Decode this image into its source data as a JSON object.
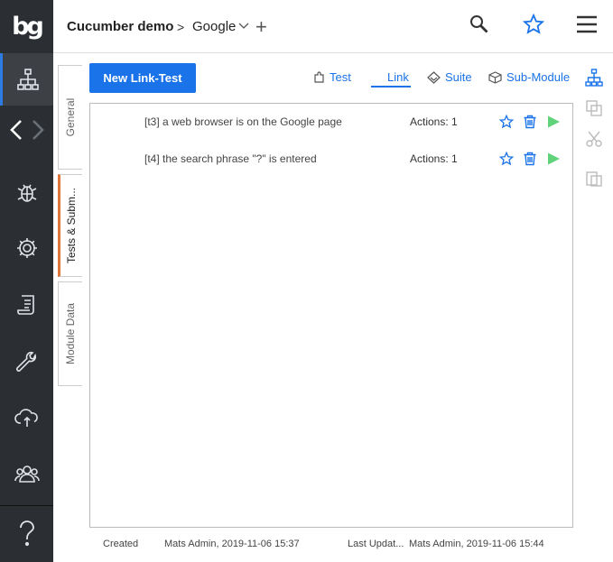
{
  "app": {
    "logo_text": "bg",
    "accent": "#1a73e8",
    "sidebar_bg": "#2b2f33"
  },
  "sidebar": {
    "items": [
      {
        "icon": "sitemap-icon",
        "active": true
      },
      {
        "icon": "back-icon"
      },
      {
        "icon": "forward-icon"
      },
      {
        "icon": "bug-icon"
      },
      {
        "icon": "gear-icon"
      },
      {
        "icon": "scroll-icon"
      },
      {
        "icon": "wrench-icon"
      },
      {
        "icon": "cloud-sync-icon"
      },
      {
        "icon": "users-icon"
      },
      {
        "icon": "help-icon"
      }
    ]
  },
  "header": {
    "project": "Cucumber demo",
    "separator": ">",
    "module": "Google",
    "add": "+"
  },
  "tabs": [
    {
      "label": "General"
    },
    {
      "label": "Tests & Subm...",
      "active": true
    },
    {
      "label": "Module Data"
    }
  ],
  "toolbar": {
    "new_button": "New Link-Test",
    "filters": {
      "test": "Test",
      "link": "Link",
      "suite": "Suite",
      "submodule": "Sub-Module"
    },
    "active_filter": "Link"
  },
  "tests": [
    {
      "name": "[t3] a web browser is on the Google page",
      "actions": "Actions: 1"
    },
    {
      "name": "[t4] the search phrase \"?\" is entered",
      "actions": "Actions: 1"
    }
  ],
  "footer": {
    "created_label": "Created",
    "created_value": "Mats Admin, 2019-11-06 15:37",
    "updated_label": "Last Updat...",
    "updated_value": "Mats Admin, 2019-11-06 15:44"
  }
}
